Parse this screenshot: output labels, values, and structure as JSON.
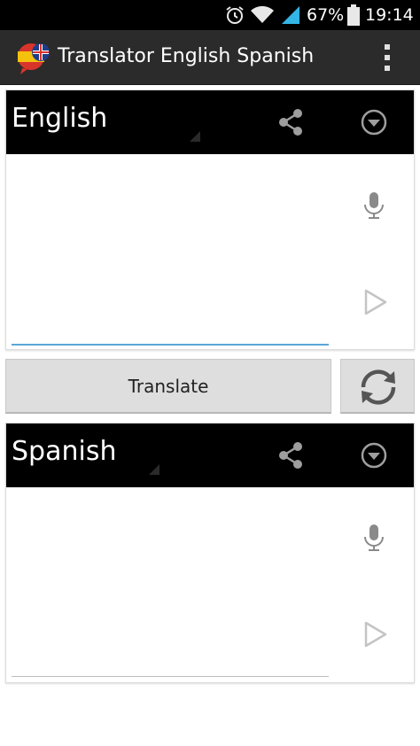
{
  "status_bar": {
    "battery_text": "67%",
    "time": "19:14",
    "icons": [
      "alarm-icon",
      "wifi-icon",
      "signal-icon",
      "battery-icon"
    ]
  },
  "action_bar": {
    "title": "Translator English Spanish",
    "app_icon": "spain-uk-flag-bubble-icon",
    "overflow_icon": "overflow-menu-icon"
  },
  "source_panel": {
    "language": "English",
    "icons": [
      "share-icon",
      "dropdown-circle-icon",
      "microphone-icon",
      "play-icon"
    ],
    "text_value": ""
  },
  "translate_button": {
    "label": "Translate"
  },
  "swap_button": {
    "icon": "swap-languages-icon"
  },
  "target_panel": {
    "language": "Spanish",
    "icons": [
      "share-icon",
      "dropdown-circle-icon",
      "microphone-icon",
      "play-icon"
    ],
    "text_value": ""
  },
  "colors": {
    "status_bar": "#000000",
    "action_bar": "#2b2b2b",
    "panel_header": "#000000",
    "text_field_focus": "#5aa6d8",
    "button_background": "#dedede",
    "signal_accent": "#33b5e5"
  }
}
